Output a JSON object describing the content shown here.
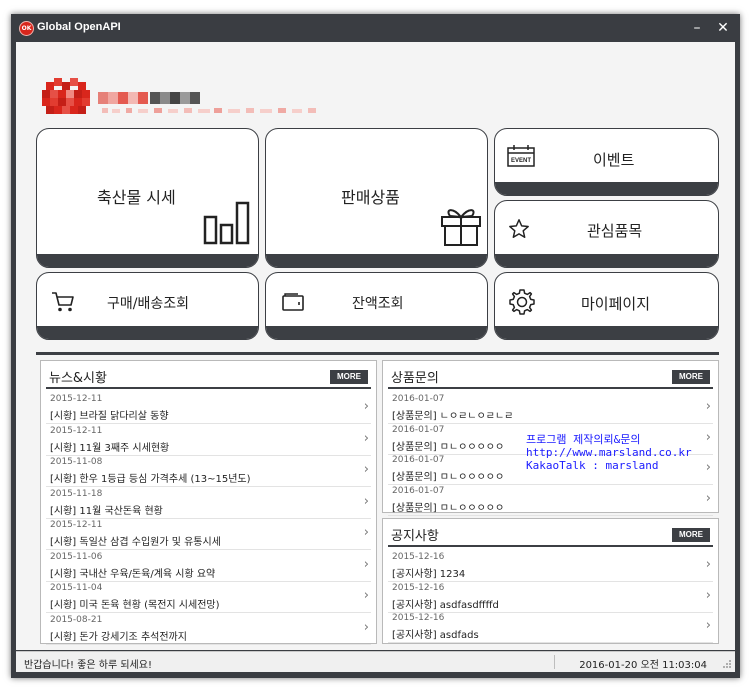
{
  "window": {
    "title": "Global OpenAPI",
    "icon_text": "OK",
    "minimize": "–",
    "close": "✕"
  },
  "logo": {
    "icon": "blurred-brand-logo"
  },
  "tiles": {
    "livestock_price": {
      "label": "축산물 시세",
      "icon": "bar-chart-icon"
    },
    "products": {
      "label": "판매상품",
      "icon": "gift-icon"
    },
    "event": {
      "label": "이벤트",
      "icon": "event-icon",
      "icon_text": "EVENT"
    },
    "favorites": {
      "label": "관심품목",
      "icon": "star-icon"
    },
    "orders": {
      "label": "구매/배송조회",
      "icon": "cart-icon"
    },
    "balance": {
      "label": "잔액조회",
      "icon": "wallet-icon"
    },
    "mypage": {
      "label": "마이페이지",
      "icon": "gear-icon"
    }
  },
  "news": {
    "title": "뉴스&시황",
    "more": "MORE",
    "items": [
      {
        "date": "2015-12-11",
        "text": "[시황] 브라질 닭다리살 동향"
      },
      {
        "date": "2015-12-11",
        "text": "[시황] 11월 3째주 시세현황"
      },
      {
        "date": "2015-11-08",
        "text": "[시황] 한우 1등급 등심 가격추세 (13~15년도)"
      },
      {
        "date": "2015-11-18",
        "text": "[시황] 11월 국산돈육 현황"
      },
      {
        "date": "2015-12-11",
        "text": "[시황] 독일산 삼겹 수입원가 및 유통시세"
      },
      {
        "date": "2015-11-06",
        "text": "[시황] 국내산 우육/돈육/계육 시황 요약"
      },
      {
        "date": "2015-11-04",
        "text": "[시황] 미국 돈육 현황 (목전지 시세전망)"
      },
      {
        "date": "2015-08-21",
        "text": "[시황] 돈가 강세기조 추석전까지"
      }
    ]
  },
  "inquiry": {
    "title": "상품문의",
    "more": "MORE",
    "items": [
      {
        "date": "2016-01-07",
        "text": "[상품문의] ㄴㅇㄹㄴㅇㄹㄴㄹ"
      },
      {
        "date": "2016-01-07",
        "text": "[상품문의] ㅁㄴㅇㅇㅇㅇㅇ"
      },
      {
        "date": "2016-01-07",
        "text": "[상품문의] ㅁㄴㅇㅇㅇㅇㅇ"
      },
      {
        "date": "2016-01-07",
        "text": "[상품문의] ㅁㄴㅇㅇㅇㅇㅇ"
      }
    ]
  },
  "notice": {
    "title": "공지사항",
    "more": "MORE",
    "items": [
      {
        "date": "2015-12-16",
        "text": "[공지사항] 1234"
      },
      {
        "date": "2015-12-16",
        "text": "[공지사항] asdfasdffffd"
      },
      {
        "date": "2015-12-16",
        "text": "[공지사항] asdfads"
      }
    ]
  },
  "overlay": {
    "line1": "프로그램 제작의뢰&문의",
    "line2": "http://www.marsland.co.kr",
    "line3": "KakaoTalk : marsland"
  },
  "status": {
    "message": "반갑습니다! 좋은 하루 되세요!",
    "datetime": "2016-01-20 오전 11:03:04"
  },
  "colors": {
    "frame": "#3a3d42",
    "tile_border": "#3c3f44",
    "client_bg": "#f4f4f4",
    "overlay_text": "#1a1aff",
    "logo_red": "#d9261c"
  }
}
